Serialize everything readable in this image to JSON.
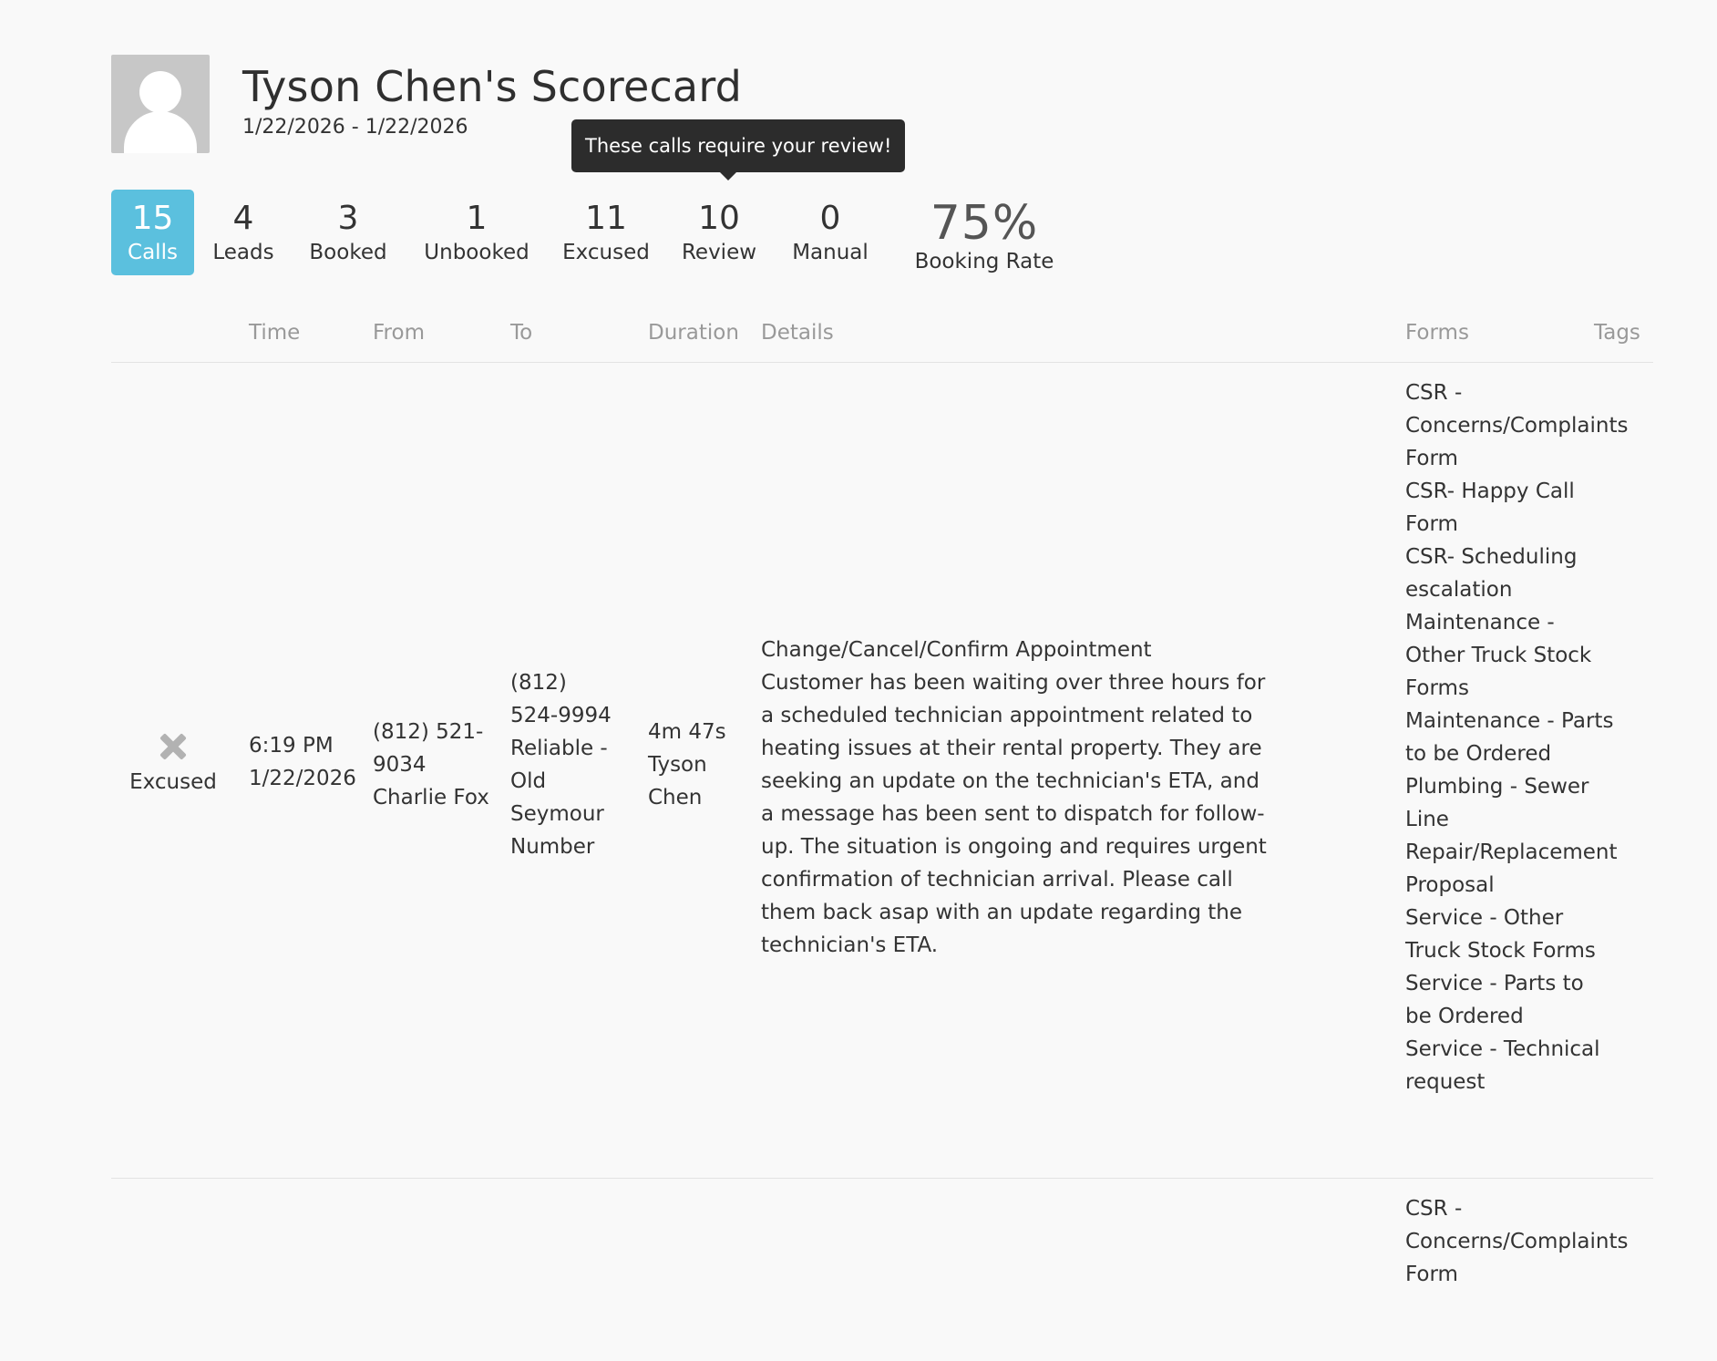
{
  "header": {
    "title": "Tyson Chen's Scorecard",
    "date_range": "1/22/2026 - 1/22/2026"
  },
  "tooltip": {
    "text": "These calls require your review!"
  },
  "stats": [
    {
      "value": "15",
      "label": "Calls"
    },
    {
      "value": "4",
      "label": "Leads"
    },
    {
      "value": "3",
      "label": "Booked"
    },
    {
      "value": "1",
      "label": "Unbooked"
    },
    {
      "value": "11",
      "label": "Excused"
    },
    {
      "value": "10",
      "label": "Review"
    },
    {
      "value": "0",
      "label": "Manual"
    }
  ],
  "booking_rate": {
    "value": "75%",
    "label": "Booking Rate"
  },
  "table": {
    "headers": {
      "time": "Time",
      "from": "From",
      "to": "To",
      "duration": "Duration",
      "details": "Details",
      "forms": "Forms",
      "tags": "Tags"
    },
    "rows": [
      {
        "status": "Excused",
        "time": "6:19 PM",
        "date": "1/22/2026",
        "from_number": "(812) 521-9034",
        "from_name": "Charlie Fox",
        "to_number": "(812) 524-9994",
        "to_name": "Reliable - Old Seymour Number",
        "duration": "4m 47s",
        "agent": "Tyson Chen",
        "details_title": "Change/Cancel/Confirm Appointment",
        "details_body": "Customer has been waiting over three hours for a scheduled technician appointment related to heating issues at their rental property. They are seeking an update on the technician's ETA, and a message has been sent to dispatch for follow-up. The situation is ongoing and requires urgent confirmation of technician arrival. Please call them back asap with an update regarding the technician's ETA.",
        "forms": [
          "CSR - Concerns/Complaints Form",
          "CSR- Happy Call Form",
          "CSR- Scheduling escalation",
          "Maintenance - Other Truck Stock Forms",
          "Maintenance - Parts to be Ordered",
          "Plumbing - Sewer Line Repair/Replacement Proposal",
          "Service - Other Truck Stock Forms",
          "Service - Parts to be Ordered",
          "Service - Technical request"
        ]
      },
      {
        "forms": [
          "CSR - Concerns/Complaints Form"
        ]
      }
    ]
  }
}
